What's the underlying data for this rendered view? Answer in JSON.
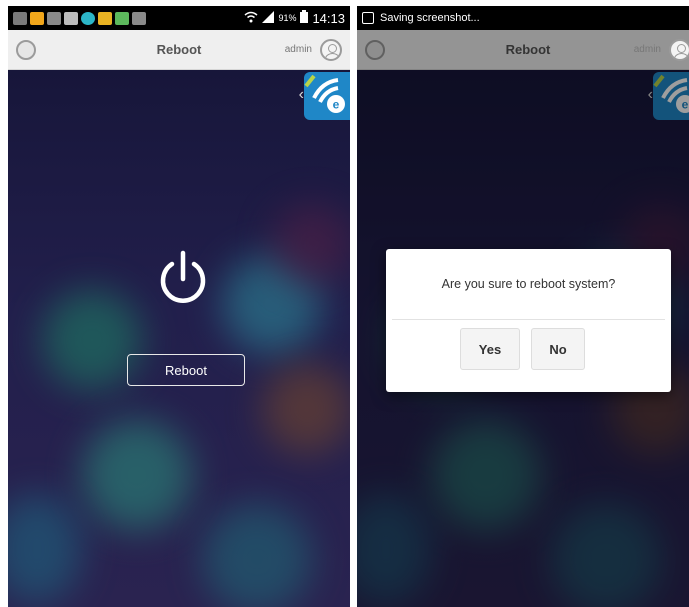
{
  "left": {
    "status_bar": {
      "time": "14:13",
      "battery": "91%"
    },
    "app_bar": {
      "title": "Reboot",
      "user": "admin"
    },
    "reboot_button": "Reboot"
  },
  "right": {
    "status_bar": {
      "toast": "Saving screenshot..."
    },
    "app_bar": {
      "title": "Reboot",
      "user": "admin"
    },
    "dialog": {
      "message": "Are you sure to reboot system?",
      "yes_label": "Yes",
      "no_label": "No"
    }
  },
  "icons": [
    "power-icon",
    "wifi-badge-icon",
    "chevron-left-icon",
    "avatar-icon",
    "signal-icon",
    "battery-icon",
    "screenshot-icon"
  ],
  "colors": {
    "accent": "#1f87c7",
    "background": "#1f1b45",
    "app_bar": "#efefef",
    "dialog": "#ffffff"
  }
}
